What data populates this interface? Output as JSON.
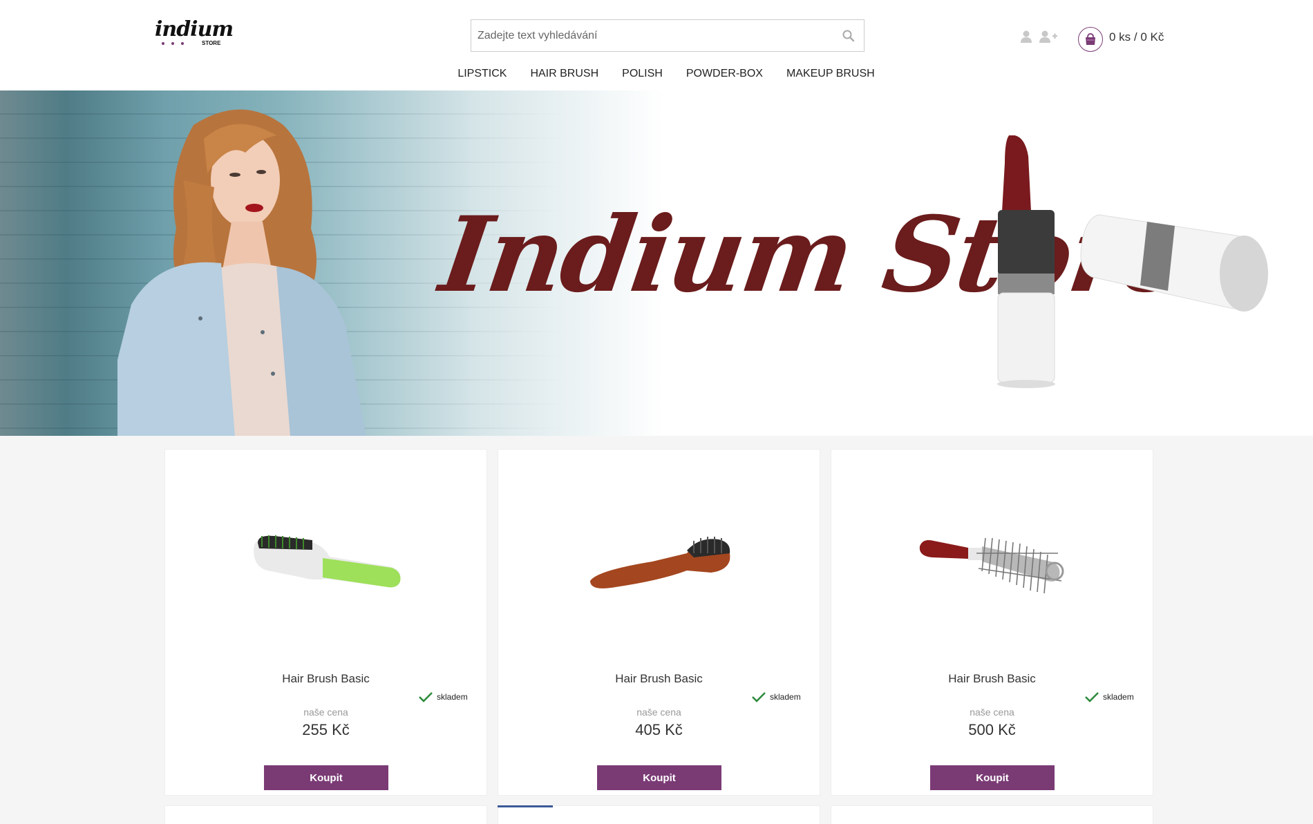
{
  "header": {
    "logo": {
      "name": "indium",
      "sub": "STORE"
    },
    "search": {
      "placeholder": "Zadejte text vyhledávání"
    },
    "icons": {
      "login": "user-icon",
      "register": "user-plus-icon",
      "cart": "shopping-bag-icon",
      "search": "search-icon"
    },
    "cart_summary": "0 ks / 0 Kč"
  },
  "nav": {
    "items": [
      {
        "label": "LIPSTICK"
      },
      {
        "label": "HAIR BRUSH"
      },
      {
        "label": "POLISH"
      },
      {
        "label": "POWDER-BOX"
      },
      {
        "label": "MAKEUP BRUSH"
      }
    ]
  },
  "hero": {
    "title": "Indium Store"
  },
  "products": [
    {
      "name": "Hair Brush Basic",
      "stock": "skladem",
      "price_label": "naše cena",
      "price": "255 Kč",
      "buy": "Koupit",
      "image": "green-hair-brush"
    },
    {
      "name": "Hair Brush Basic",
      "stock": "skladem",
      "price_label": "naše cena",
      "price": "405 Kč",
      "buy": "Koupit",
      "image": "wooden-hair-brush"
    },
    {
      "name": "Hair Brush Basic",
      "stock": "skladem",
      "price_label": "naše cena",
      "price": "500 Kč",
      "buy": "Koupit",
      "image": "round-hair-brush"
    }
  ],
  "colors": {
    "accent": "#7a3b75",
    "hero_title": "#6b1c1c",
    "stock_check": "#2e8b3d"
  }
}
